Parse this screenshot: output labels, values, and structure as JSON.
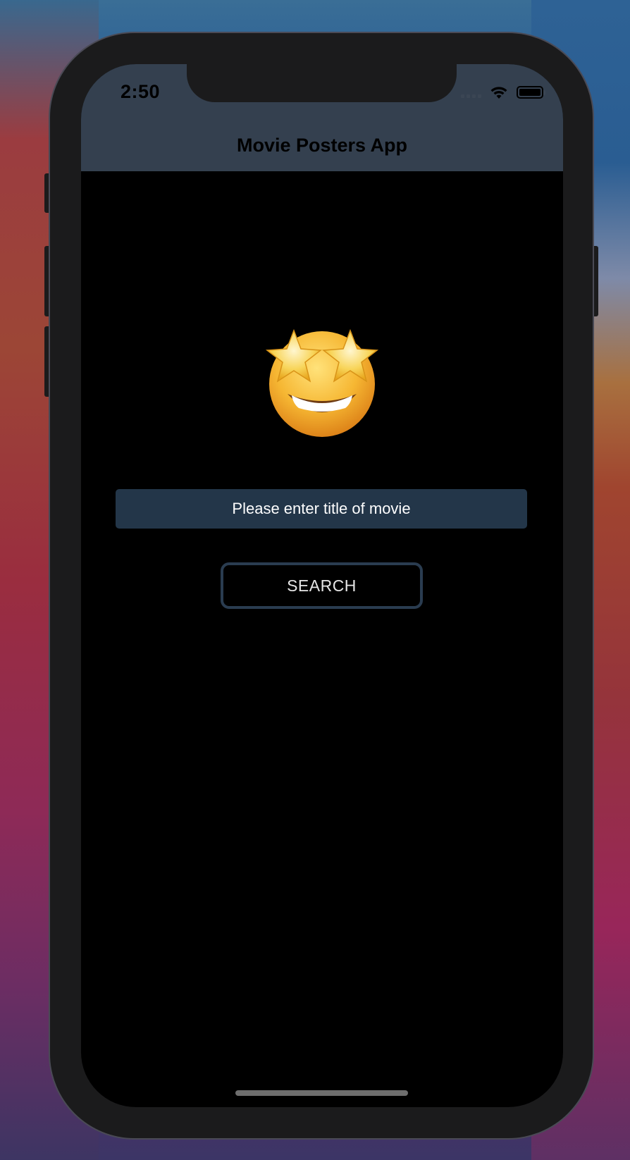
{
  "status_bar": {
    "time": "2:50"
  },
  "header": {
    "title": "Movie Posters App",
    "background_color": "#34404f"
  },
  "hero": {
    "emoji": "star-struck-emoji"
  },
  "search": {
    "placeholder": "Please enter title of movie",
    "value": "",
    "button_label": "SEARCH",
    "input_background": "#233649",
    "button_border_color": "#2a3c50"
  },
  "icons": {
    "wifi": "wifi-icon",
    "signal": "cellular-signal-icon",
    "battery": "battery-icon"
  }
}
